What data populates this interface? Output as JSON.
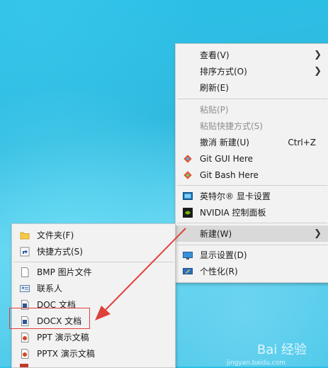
{
  "context_menu": {
    "items": [
      {
        "label": "查看(V)",
        "has_submenu": true
      },
      {
        "label": "排序方式(O)",
        "has_submenu": true
      },
      {
        "label": "刷新(E)"
      },
      {
        "label": "粘贴(P)",
        "disabled": true
      },
      {
        "label": "粘贴快捷方式(S)",
        "disabled": true
      },
      {
        "label": "撤消 新建(U)",
        "accelerator": "Ctrl+Z"
      },
      {
        "label": "Git GUI Here",
        "icon": "git-gui-icon"
      },
      {
        "label": "Git Bash Here",
        "icon": "git-bash-icon"
      },
      {
        "label": "英特尔® 显卡设置",
        "icon": "intel-graphics-icon"
      },
      {
        "label": "NVIDIA 控制面板",
        "icon": "nvidia-icon"
      },
      {
        "label": "新建(W)",
        "has_submenu": true,
        "highlighted": true
      },
      {
        "label": "显示设置(D)",
        "icon": "display-settings-icon"
      },
      {
        "label": "个性化(R)",
        "icon": "personalize-icon"
      }
    ]
  },
  "new_submenu": {
    "items": [
      {
        "label": "文件夹(F)",
        "icon": "folder-icon"
      },
      {
        "label": "快捷方式(S)",
        "icon": "shortcut-icon"
      },
      {
        "label": "BMP 图片文件",
        "icon": "bmp-file-icon"
      },
      {
        "label": "联系人",
        "icon": "contact-icon"
      },
      {
        "label": "DOC 文档",
        "icon": "doc-file-icon"
      },
      {
        "label": "DOCX 文档",
        "icon": "docx-file-icon"
      },
      {
        "label": "PPT 演示文稿",
        "icon": "ppt-file-icon"
      },
      {
        "label": "PPTX 演示文稿",
        "icon": "pptx-file-icon"
      }
    ]
  },
  "watermark": {
    "text": "Bai 经验",
    "url": "jingyan.baidu.com"
  },
  "colors": {
    "annotation_red": "#e0413b",
    "menu_bg": "#f2f2f2",
    "highlight": "#d9d9d9"
  }
}
